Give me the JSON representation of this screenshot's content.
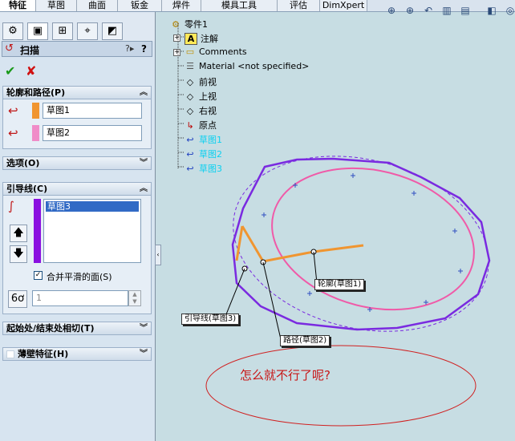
{
  "tabs": [
    "特征",
    "草图",
    "曲面",
    "钣金",
    "焊件",
    "模具工具",
    "评估",
    "DimXpert"
  ],
  "panel": {
    "title": "扫描",
    "help_label": "?",
    "sections": {
      "profile_path": {
        "title": "轮廓和路径(P)",
        "profile_value": "草图1",
        "path_value": "草图2"
      },
      "options": {
        "title": "选项(O)"
      },
      "guides": {
        "title": "引导线(C)",
        "list_items": [
          "草图3"
        ],
        "merge_label": "合并平滑的面(S)",
        "spin_value": "1"
      },
      "tangency": {
        "title": "起始处/结束处相切(T)"
      },
      "thin": {
        "title": "薄壁特征(H)"
      }
    }
  },
  "tree": {
    "root": "零件1",
    "items": [
      "注解",
      "Comments",
      "Material <not specified>",
      "前视",
      "上视",
      "右视",
      "原点",
      "草图1",
      "草图2",
      "草图3"
    ]
  },
  "callouts": {
    "profile": "轮廓(草图1)",
    "guide": "引导线(草图3)",
    "path": "路径(草图2)"
  },
  "annotation": "怎么就不行了呢?",
  "colors": {
    "profile_swatch": "#f09530",
    "path_swatch": "#f08cc8",
    "guide_swatch": "#8a10e0"
  }
}
